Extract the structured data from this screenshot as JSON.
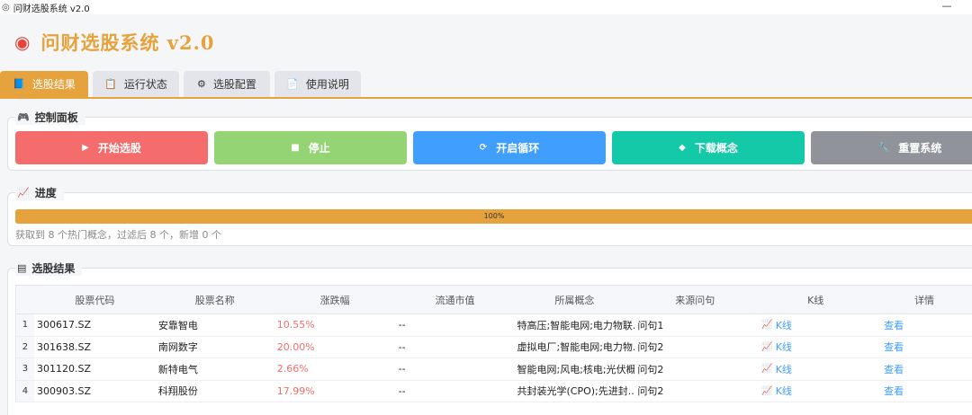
{
  "window": {
    "title": "问财选股系统 v2.0",
    "min_symbol": "—"
  },
  "header": {
    "logo_glyph": "◉",
    "title": "问财选股系统 v2.0"
  },
  "tabs": [
    {
      "label": "选股结果",
      "icon": "📘",
      "active": true
    },
    {
      "label": "运行状态",
      "icon": "📋",
      "active": false
    },
    {
      "label": "选股配置",
      "icon": "⚙",
      "active": false
    },
    {
      "label": "使用说明",
      "icon": "📄",
      "active": false
    }
  ],
  "control_panel": {
    "title": "控制面板",
    "icon": "🎮",
    "buttons": {
      "start": {
        "label": "开始选股",
        "icon": "▶"
      },
      "stop": {
        "label": "停止",
        "icon": "■"
      },
      "loop": {
        "label": "开启循环",
        "icon": "⟳"
      },
      "download": {
        "label": "下载概念",
        "icon": "◆"
      },
      "reset": {
        "label": "重置系统",
        "icon": "🔧"
      }
    }
  },
  "progress_panel": {
    "title": "进度",
    "icon": "📈",
    "percent": 100,
    "percent_text": "100%",
    "status": "获取到 8 个热门概念，过滤后 8 个，新增 0 个"
  },
  "results_panel": {
    "title": "选股结果",
    "icon": "▤",
    "columns": [
      "股票代码",
      "股票名称",
      "涨跌幅",
      "流通市值",
      "所属概念",
      "来源问句",
      "K线",
      "详情"
    ],
    "rows": [
      {
        "index": "1",
        "code": "300617.SZ",
        "name": "安靠智电",
        "change": "10.55%",
        "mcap": "--",
        "concept": "特高压;智能电网;电力物联...",
        "source": "问句1",
        "kline": "K线",
        "detail": "查看"
      },
      {
        "index": "2",
        "code": "301638.SZ",
        "name": "南网数字",
        "change": "20.00%",
        "mcap": "--",
        "concept": "虚拟电厂;智能电网;电力物...",
        "source": "问句2",
        "kline": "K线",
        "detail": "查看"
      },
      {
        "index": "3",
        "code": "301120.SZ",
        "name": "新特电气",
        "change": "2.66%",
        "mcap": "--",
        "concept": "智能电网;风电;核电;光伏概...",
        "source": "问句2",
        "kline": "K线",
        "detail": "查看"
      },
      {
        "index": "4",
        "code": "300903.SZ",
        "name": "科翔股份",
        "change": "17.99%",
        "mcap": "--",
        "concept": "共封装光学(CPO);先进封...",
        "source": "问句2",
        "kline": "K线",
        "detail": "查看"
      }
    ]
  },
  "colors": {
    "accent": "#e6a23c",
    "start": "#f56c6c",
    "stop": "#95d475",
    "loop": "#409eff",
    "download": "#13c9a8",
    "reset": "#909399",
    "rise": "#f56c6c",
    "link": "#409eff"
  }
}
